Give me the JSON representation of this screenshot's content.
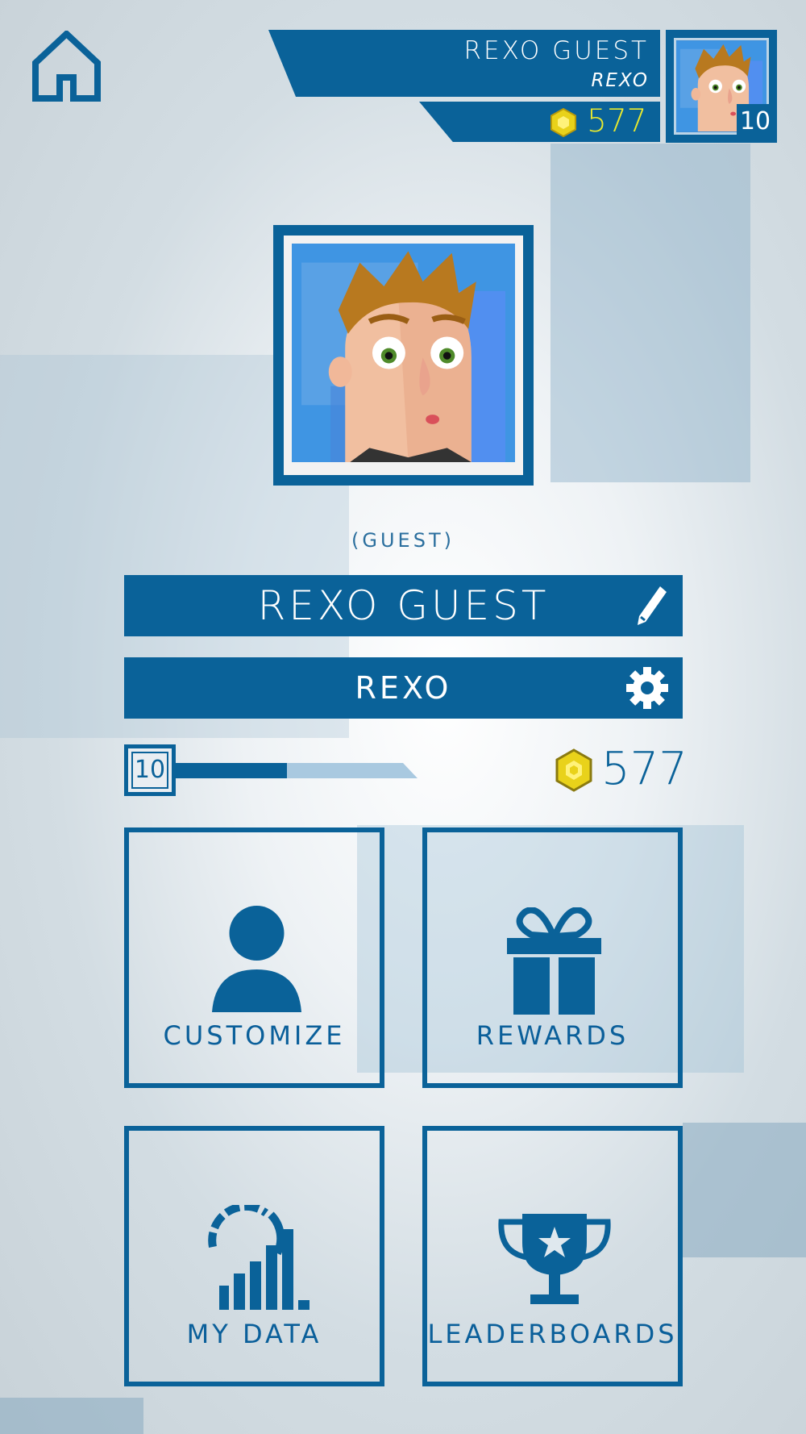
{
  "header": {
    "player_name": "REXO GUEST",
    "team_name": "REXO",
    "coins": "577",
    "level": "10"
  },
  "profile": {
    "status_label": "(GUEST)",
    "name": "REXO GUEST",
    "team": "REXO",
    "level": "10",
    "xp_progress_fraction": 0.46,
    "coins": "577"
  },
  "tiles": {
    "customize": "CUSTOMIZE",
    "rewards": "REWARDS",
    "my_data": "MY DATA",
    "leaderboards": "LEADERBOARDS"
  },
  "icons": {
    "home": "home-icon",
    "edit": "pencil-icon",
    "settings": "gear-icon",
    "coin": "coin-icon",
    "customize": "person-icon",
    "rewards": "gift-icon",
    "my_data": "chart-icon",
    "leaderboards": "trophy-icon"
  },
  "colors": {
    "primary": "#0a6299",
    "coin_yellow": "#e9ea2e",
    "background": "#dde5ea"
  }
}
